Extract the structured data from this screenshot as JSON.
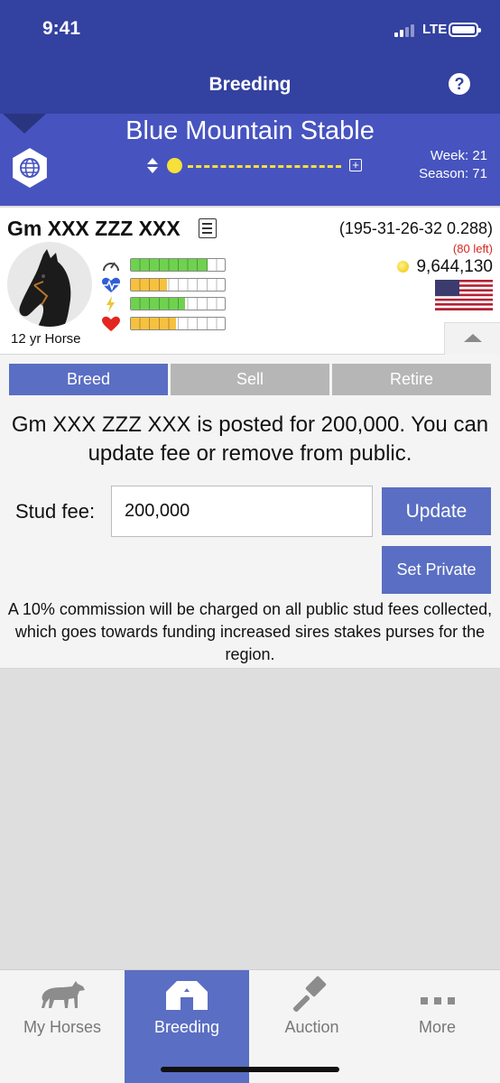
{
  "status_bar": {
    "time": "9:41",
    "network": "LTE"
  },
  "nav": {
    "title": "Breeding"
  },
  "stable": {
    "name": "Blue Mountain Stable",
    "week": "Week: 21",
    "season": "Season: 71"
  },
  "horse": {
    "name": "Gm XXX ZZZ XXX",
    "record": "(195-31-26-32 0.288)",
    "left": "(80 left)",
    "balance": "9,644,130",
    "age": "12 yr Horse",
    "stats": [
      {
        "icon": "speedometer-icon",
        "level": 0.82,
        "color": "#6ed24f"
      },
      {
        "icon": "heartbeat-icon",
        "level": 0.38,
        "color": "#f7c13f"
      },
      {
        "icon": "lightning-icon",
        "level": 0.58,
        "color": "#6ed24f"
      },
      {
        "icon": "heart-icon",
        "level": 0.48,
        "color": "#f7c13f"
      }
    ]
  },
  "tabs": {
    "breed": "Breed",
    "sell": "Sell",
    "retire": "Retire"
  },
  "breed": {
    "message": "Gm XXX ZZZ XXX is posted for 200,000. You can update fee or remove from public.",
    "fee_label": "Stud fee:",
    "fee_value": "200,000",
    "update_label": "Update",
    "set_private_label": "Set Private",
    "commission": "A 10% commission will be charged on all public stud fees collected, which goes towards funding increased sires stakes purses for the region."
  },
  "bottom_nav": {
    "items": [
      {
        "label": "My Horses",
        "icon": "horse-icon"
      },
      {
        "label": "Breeding",
        "icon": "barn-icon"
      },
      {
        "label": "Auction",
        "icon": "gavel-icon"
      },
      {
        "label": "More",
        "icon": "more-icon"
      }
    ]
  },
  "colors": {
    "header": "#3341a0",
    "stable_bar": "#4754bf",
    "accent": "#5a6ec3",
    "inactive_tab": "#b6b6b6",
    "warning": "#d7261e"
  }
}
